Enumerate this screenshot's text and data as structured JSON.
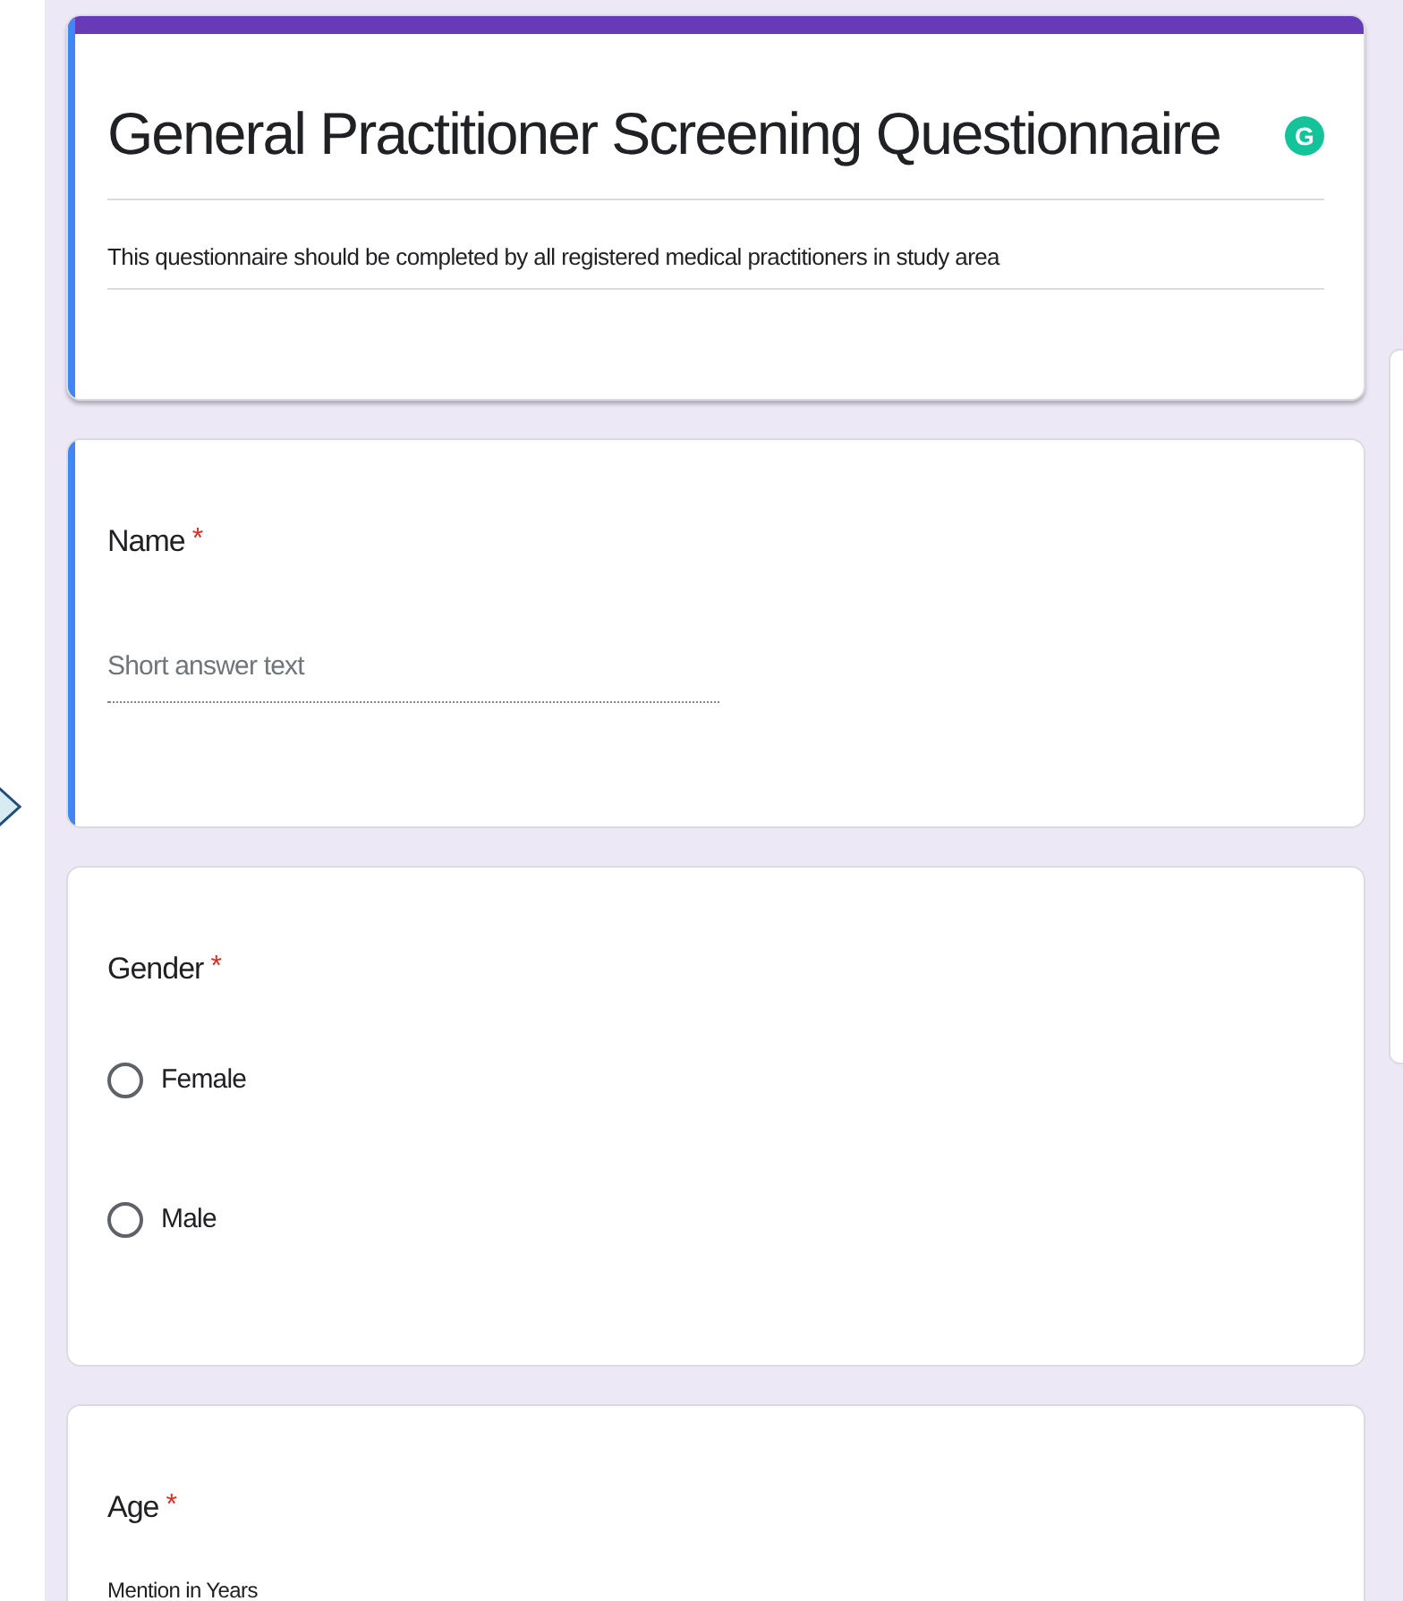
{
  "form": {
    "title": "General Practitioner Screening Questionnaire",
    "description": "This questionnaire should be completed by all registered medical practitioners in study area",
    "account_badge": "G"
  },
  "questions": [
    {
      "kind": "short_answer",
      "title": "Name",
      "required_mark": "*",
      "active": true,
      "placeholder": "Short answer text"
    },
    {
      "kind": "radio",
      "title": "Gender",
      "required_mark": "*",
      "active": false,
      "options": [
        {
          "label": "Female",
          "selected": false
        },
        {
          "label": "Male",
          "selected": false
        }
      ]
    },
    {
      "kind": "described",
      "title": "Age",
      "required_mark": "*",
      "active": false,
      "description": "Mention in Years"
    }
  ]
}
